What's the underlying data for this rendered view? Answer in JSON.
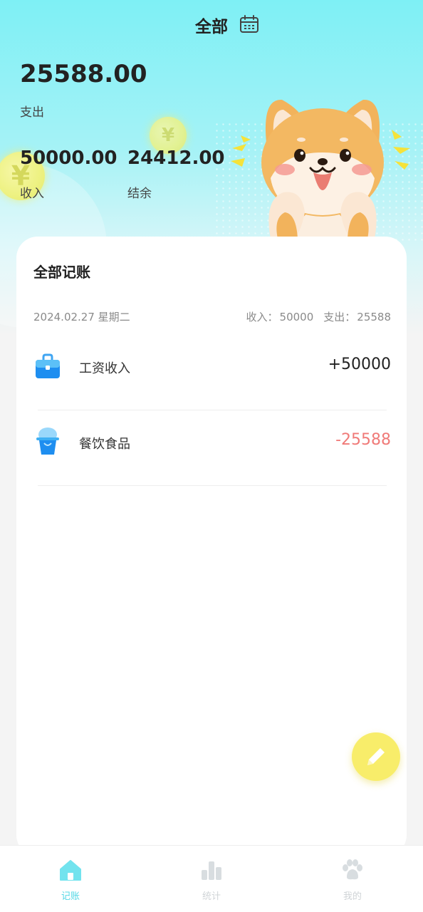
{
  "header": {
    "title": "全部",
    "calendar_icon": "calendar-icon"
  },
  "summary": {
    "expense_value": "25588.00",
    "expense_label": "支出",
    "income_value": "50000.00",
    "income_label": "收入",
    "balance_value": "24412.00",
    "balance_label": "结余"
  },
  "records_card": {
    "title": "全部记账",
    "date": "2024.02.27 星期二",
    "day_income_label": "收入：",
    "day_income_value": "50000",
    "day_expense_label": "支出：",
    "day_expense_value": "25588",
    "items": [
      {
        "icon": "briefcase-icon",
        "name": "工资收入",
        "amount": "+50000"
      },
      {
        "icon": "food-cup-icon",
        "name": "餐饮食品",
        "amount": "-25588"
      }
    ]
  },
  "fab": {
    "icon": "pencil-icon"
  },
  "tabbar": {
    "tabs": [
      {
        "label": "记账",
        "icon": "home-icon",
        "active": true
      },
      {
        "label": "统计",
        "icon": "bar-chart-icon",
        "active": false
      },
      {
        "label": "我的",
        "icon": "paw-icon",
        "active": false
      }
    ]
  },
  "colors": {
    "accent": "#6fe4ee",
    "income": "#222222",
    "expense": "#f07a78",
    "fab": "#f8ed6a",
    "inactive_tab": "#d8dde0"
  }
}
